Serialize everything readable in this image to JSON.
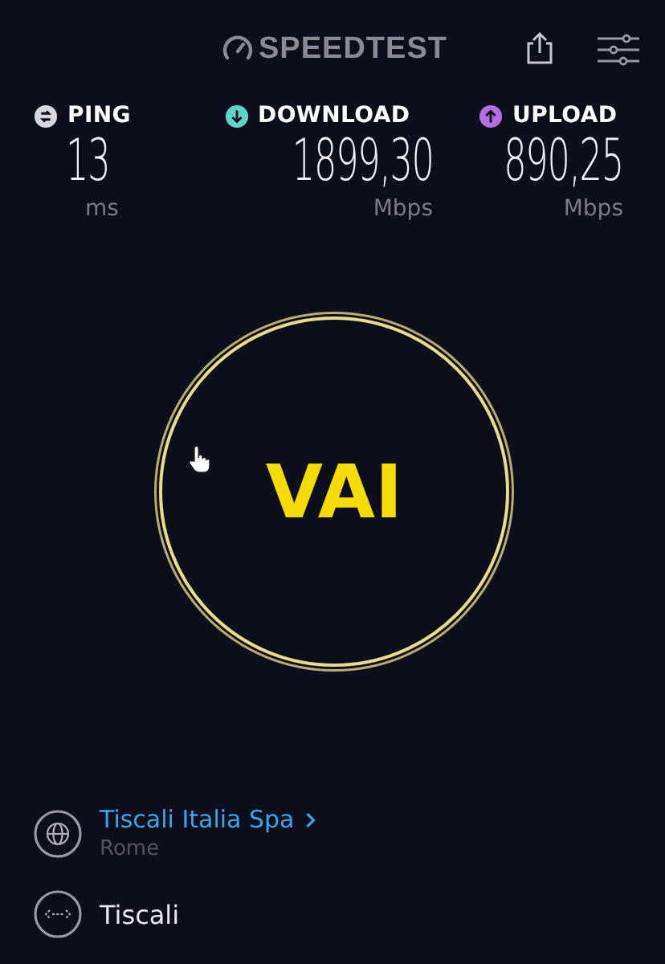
{
  "header": {
    "logo": "SPEEDTEST"
  },
  "metrics": [
    {
      "kind": "ping",
      "label": "PING",
      "value": "13",
      "unit": "ms"
    },
    {
      "kind": "download",
      "label": "DOWNLOAD",
      "value": "1899,30",
      "unit": "Mbps"
    },
    {
      "kind": "upload",
      "label": "UPLOAD",
      "value": "890,25",
      "unit": "Mbps"
    }
  ],
  "go_button": {
    "label": "VAI"
  },
  "server": {
    "name": "Tiscali Italia Spa",
    "location": "Rome"
  },
  "provider": {
    "name": "Tiscali"
  }
}
